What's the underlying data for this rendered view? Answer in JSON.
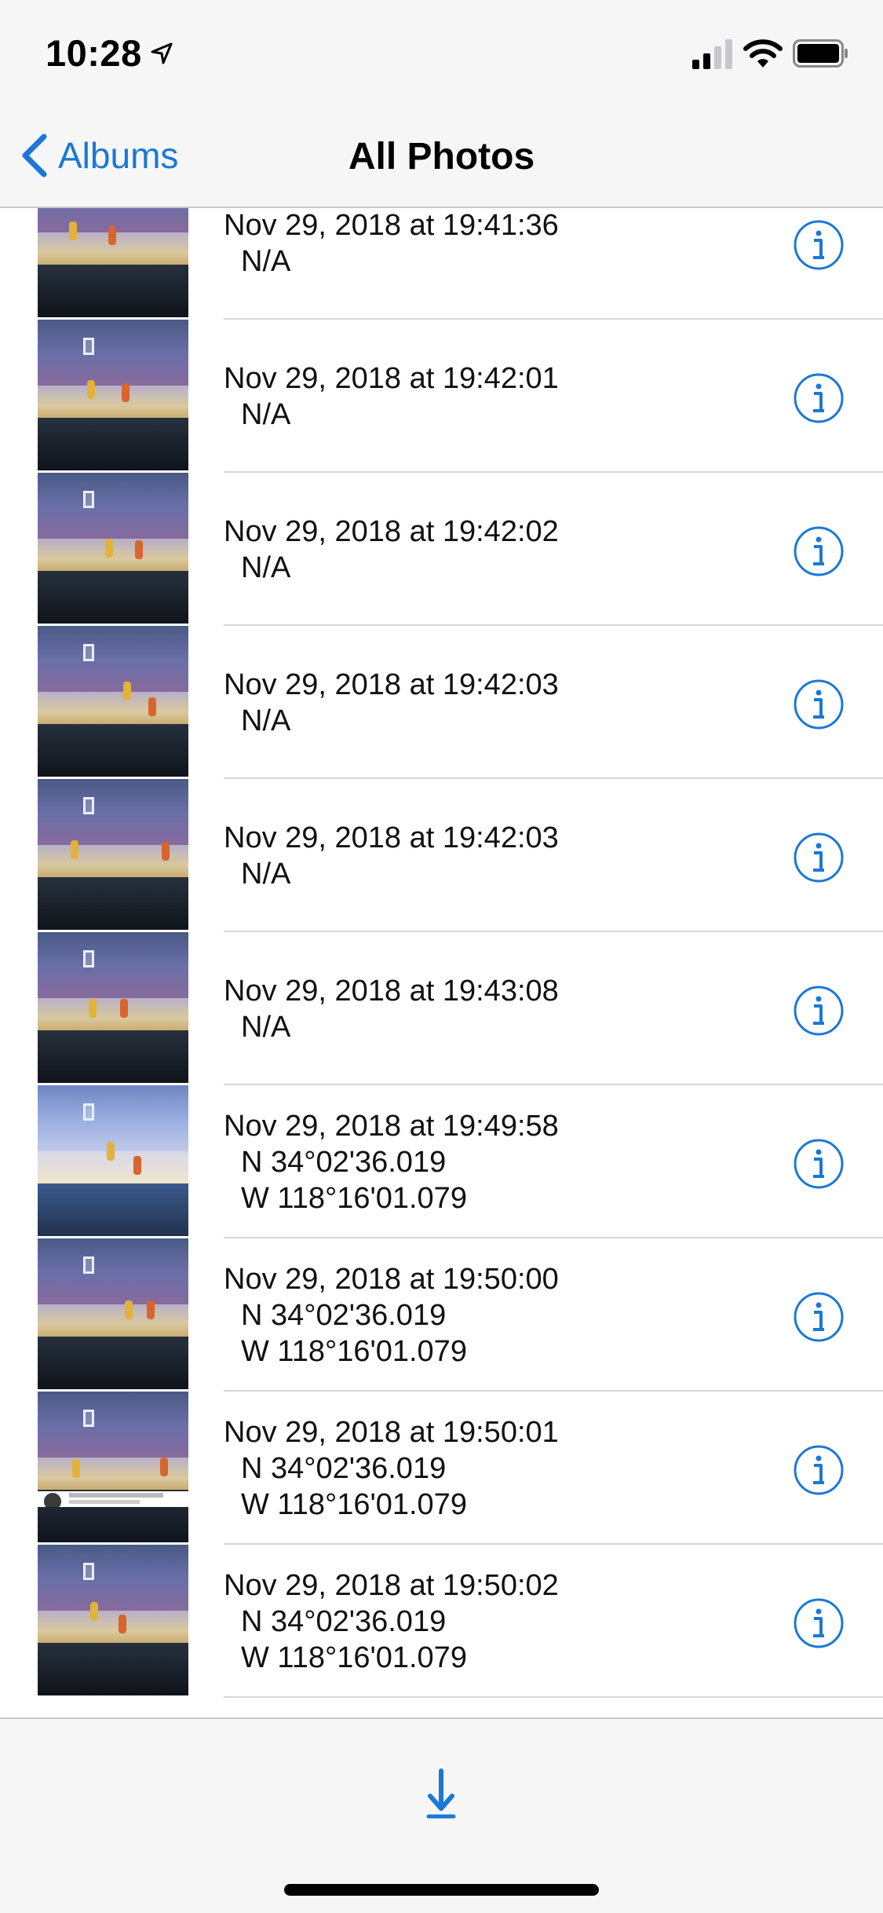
{
  "status_bar": {
    "time": "10:28",
    "icons": [
      "location-arrow-icon",
      "cellular-signal-icon",
      "wifi-icon",
      "battery-icon"
    ]
  },
  "nav": {
    "back_label": "Albums",
    "title": "All Photos"
  },
  "accent_color": "#1a78d6",
  "photos": [
    {
      "date": "Nov 29, 2018 at 19:41:36",
      "lines": [
        "N/A"
      ]
    },
    {
      "date": "Nov 29, 2018 at 19:42:01",
      "lines": [
        "N/A"
      ]
    },
    {
      "date": "Nov 29, 2018 at 19:42:02",
      "lines": [
        "N/A"
      ]
    },
    {
      "date": "Nov 29, 2018 at 19:42:03",
      "lines": [
        "N/A"
      ]
    },
    {
      "date": "Nov 29, 2018 at 19:42:03",
      "lines": [
        "N/A"
      ]
    },
    {
      "date": "Nov 29, 2018 at 19:43:08",
      "lines": [
        "N/A"
      ]
    },
    {
      "date": "Nov 29, 2018 at 19:49:58",
      "lines": [
        "N 34°02'36.019",
        "W 118°16'01.079"
      ]
    },
    {
      "date": "Nov 29, 2018 at 19:50:00",
      "lines": [
        "N 34°02'36.019",
        "W 118°16'01.079"
      ]
    },
    {
      "date": "Nov 29, 2018 at 19:50:01",
      "lines": [
        "N 34°02'36.019",
        "W 118°16'01.079"
      ]
    },
    {
      "date": "Nov 29, 2018 at 19:50:02",
      "lines": [
        "N 34°02'36.019",
        "W 118°16'01.079"
      ]
    }
  ],
  "toolbar": {
    "download_icon": "download-arrow-icon"
  }
}
